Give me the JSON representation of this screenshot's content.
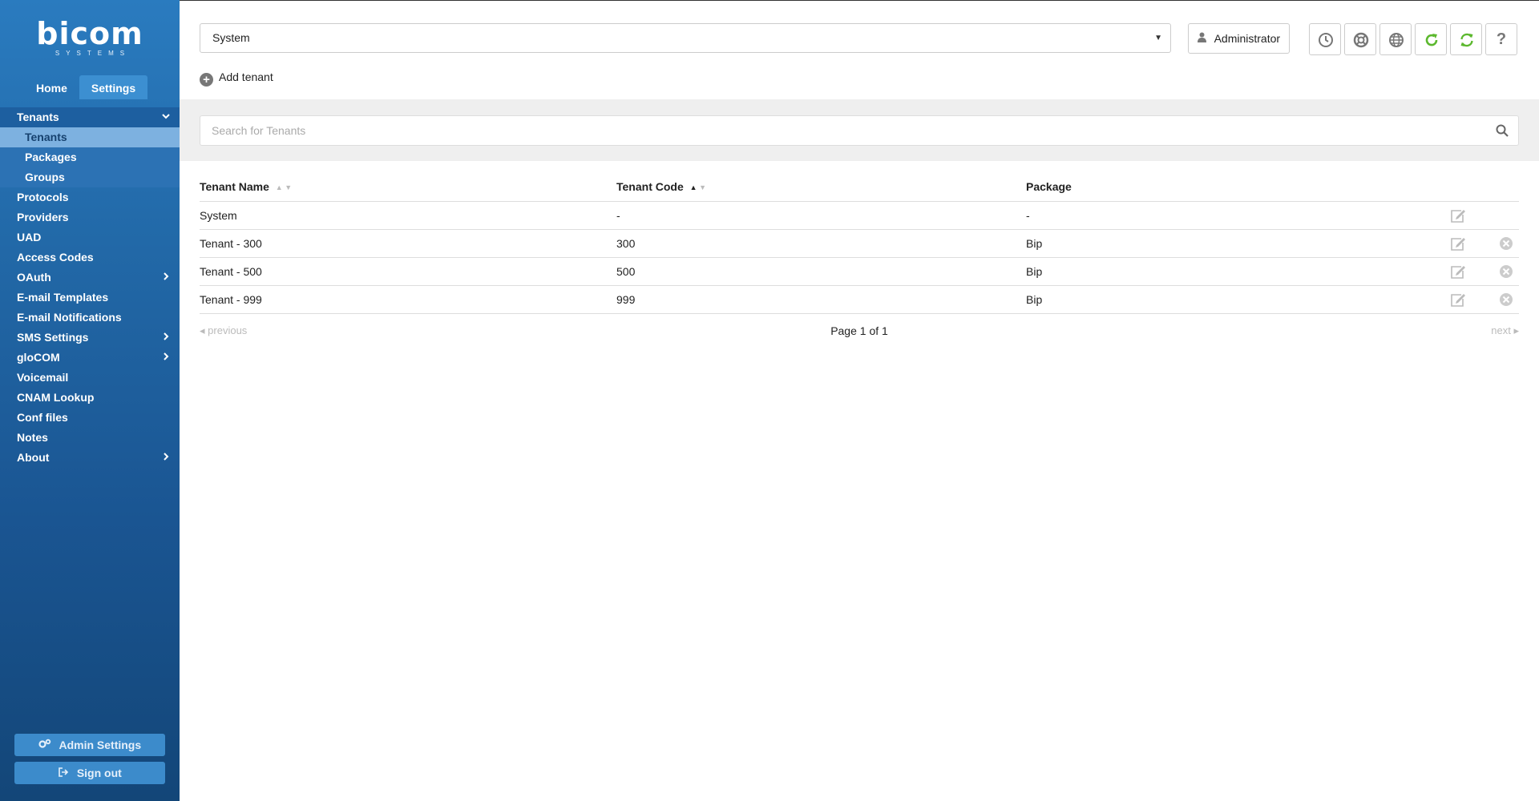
{
  "brand": {
    "logo_main": "bicom",
    "logo_sub": "SYSTEMS"
  },
  "top_tabs": [
    {
      "label": "Home",
      "active": false
    },
    {
      "label": "Settings",
      "active": true
    }
  ],
  "nav": {
    "tenants": "Tenants",
    "sub": [
      "Tenants",
      "Packages",
      "Groups"
    ],
    "items": [
      "Protocols",
      "Providers",
      "UAD",
      "Access Codes",
      "OAuth",
      "E-mail Templates",
      "E-mail Notifications",
      "SMS Settings",
      "gloCOM",
      "Voicemail",
      "CNAM Lookup",
      "Conf files",
      "Notes",
      "About"
    ]
  },
  "sidebar_buttons": {
    "admin_settings": "Admin Settings",
    "sign_out": "Sign out"
  },
  "header": {
    "tenant_select_value": "System",
    "user_label": "Administrator",
    "icons": [
      "clock-icon",
      "support-icon",
      "globe-icon",
      "reload-icon",
      "sync-icon",
      "help-icon"
    ],
    "help_glyph": "?"
  },
  "actions": {
    "add_tenant": "Add tenant"
  },
  "search": {
    "placeholder": "Search for Tenants",
    "value": ""
  },
  "table": {
    "columns": [
      "Tenant Name",
      "Tenant Code",
      "Package"
    ],
    "sort": {
      "column": "Tenant Code",
      "direction": "asc"
    },
    "rows": [
      {
        "name": "System",
        "code": "-",
        "package": "-"
      },
      {
        "name": "Tenant - 300",
        "code": "300",
        "package": "Bip"
      },
      {
        "name": "Tenant - 500",
        "code": "500",
        "package": "Bip"
      },
      {
        "name": "Tenant - 999",
        "code": "999",
        "package": "Bip"
      }
    ]
  },
  "pagination": {
    "previous": "previous",
    "page": "Page 1 of 1",
    "next": "next"
  },
  "colors": {
    "sidebar_top": "#2a7bbf",
    "sidebar_bottom": "#134678",
    "accent_green": "#5cb82e",
    "icon_gray": "#777777"
  }
}
